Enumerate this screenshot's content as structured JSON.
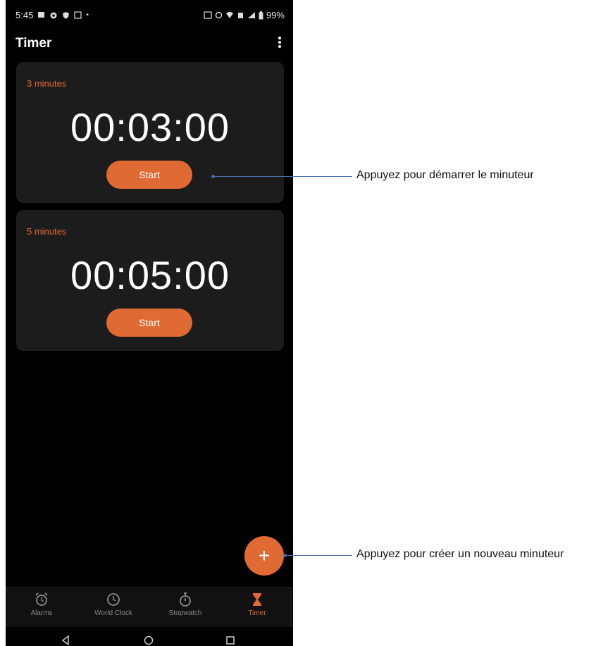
{
  "status_bar": {
    "time": "5:45",
    "battery": "99%"
  },
  "app": {
    "title": "Timer"
  },
  "timers": [
    {
      "label": "3 minutes",
      "time": "00:03:00",
      "start_label": "Start"
    },
    {
      "label": "5 minutes",
      "time": "00:05:00",
      "start_label": "Start"
    }
  ],
  "fab": {
    "symbol": "+"
  },
  "bottom_nav": [
    {
      "label": "Alarms",
      "icon": "alarm-icon"
    },
    {
      "label": "World Clock",
      "icon": "clock-icon"
    },
    {
      "label": "Stopwatch",
      "icon": "stopwatch-icon"
    },
    {
      "label": "Timer",
      "icon": "hourglass-icon",
      "active": true
    }
  ],
  "annotations": {
    "start_timer": "Appuyez pour démarrer le minuteur",
    "new_timer": "Appuyez pour créer un nouveau minuteur"
  },
  "colors": {
    "accent": "#e06a34",
    "background": "#000000",
    "card": "#1c1c1c",
    "annotation_line": "#4a6fa8"
  }
}
